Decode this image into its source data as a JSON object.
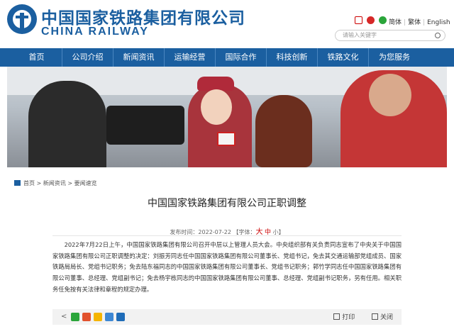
{
  "header": {
    "logo_cn": "中国国家铁路集团有限公司",
    "logo_en": "CHINA RAILWAY",
    "icons": [
      "phone-icon",
      "weibo-icon",
      "wechat-icon"
    ],
    "languages": [
      "简体",
      "繁体",
      "English"
    ],
    "search_placeholder": "请输入关键字"
  },
  "nav": {
    "items": [
      "首页",
      "公司介绍",
      "新闻资讯",
      "运输经营",
      "国际合作",
      "科技创新",
      "铁路文化",
      "为您服务"
    ]
  },
  "breadcrumb": [
    "首页",
    "新闻资讯",
    "要闻速览"
  ],
  "article": {
    "title": "中国国家铁路集团有限公司正职调整",
    "meta_prefix": "发布时间：2022-07-22 【字体：",
    "font_big": "大",
    "font_mid": "中",
    "font_small": "小",
    "meta_suffix": "】",
    "body": "2022年7月22日上午，中国国家铁路集团有限公司召开中层以上管理人员大会。中央组织部有关负责同志宣布了中央关于中国国家铁路集团有限公司正职调整的决定：刘振芳同志任中国国家铁路集团有限公司董事长、党组书记，免去其交通运输部党组成员、国家铁路局局长、党组书记职务；免去陆东福同志的中国国家铁路集团有限公司董事长、党组书记职务；郭竹学同志任中国国家铁路集团有限公司董事、总经理、党组副书记；免去杨宇栋同志的中国国家铁路集团有限公司董事、总经理、党组副书记职务，另有任用。相关职务任免按有关法律和章程的规定办理。"
  },
  "share": {
    "icons": [
      "share-icon",
      "wechat-share-icon",
      "weibo-share-icon",
      "qq-share-icon",
      "qzone-share-icon",
      "renren-share-icon"
    ],
    "print_label": "打印",
    "close_label": "关闭"
  },
  "colors": {
    "brand_blue": "#1b5fa0",
    "accent_red": "#cc0000"
  }
}
